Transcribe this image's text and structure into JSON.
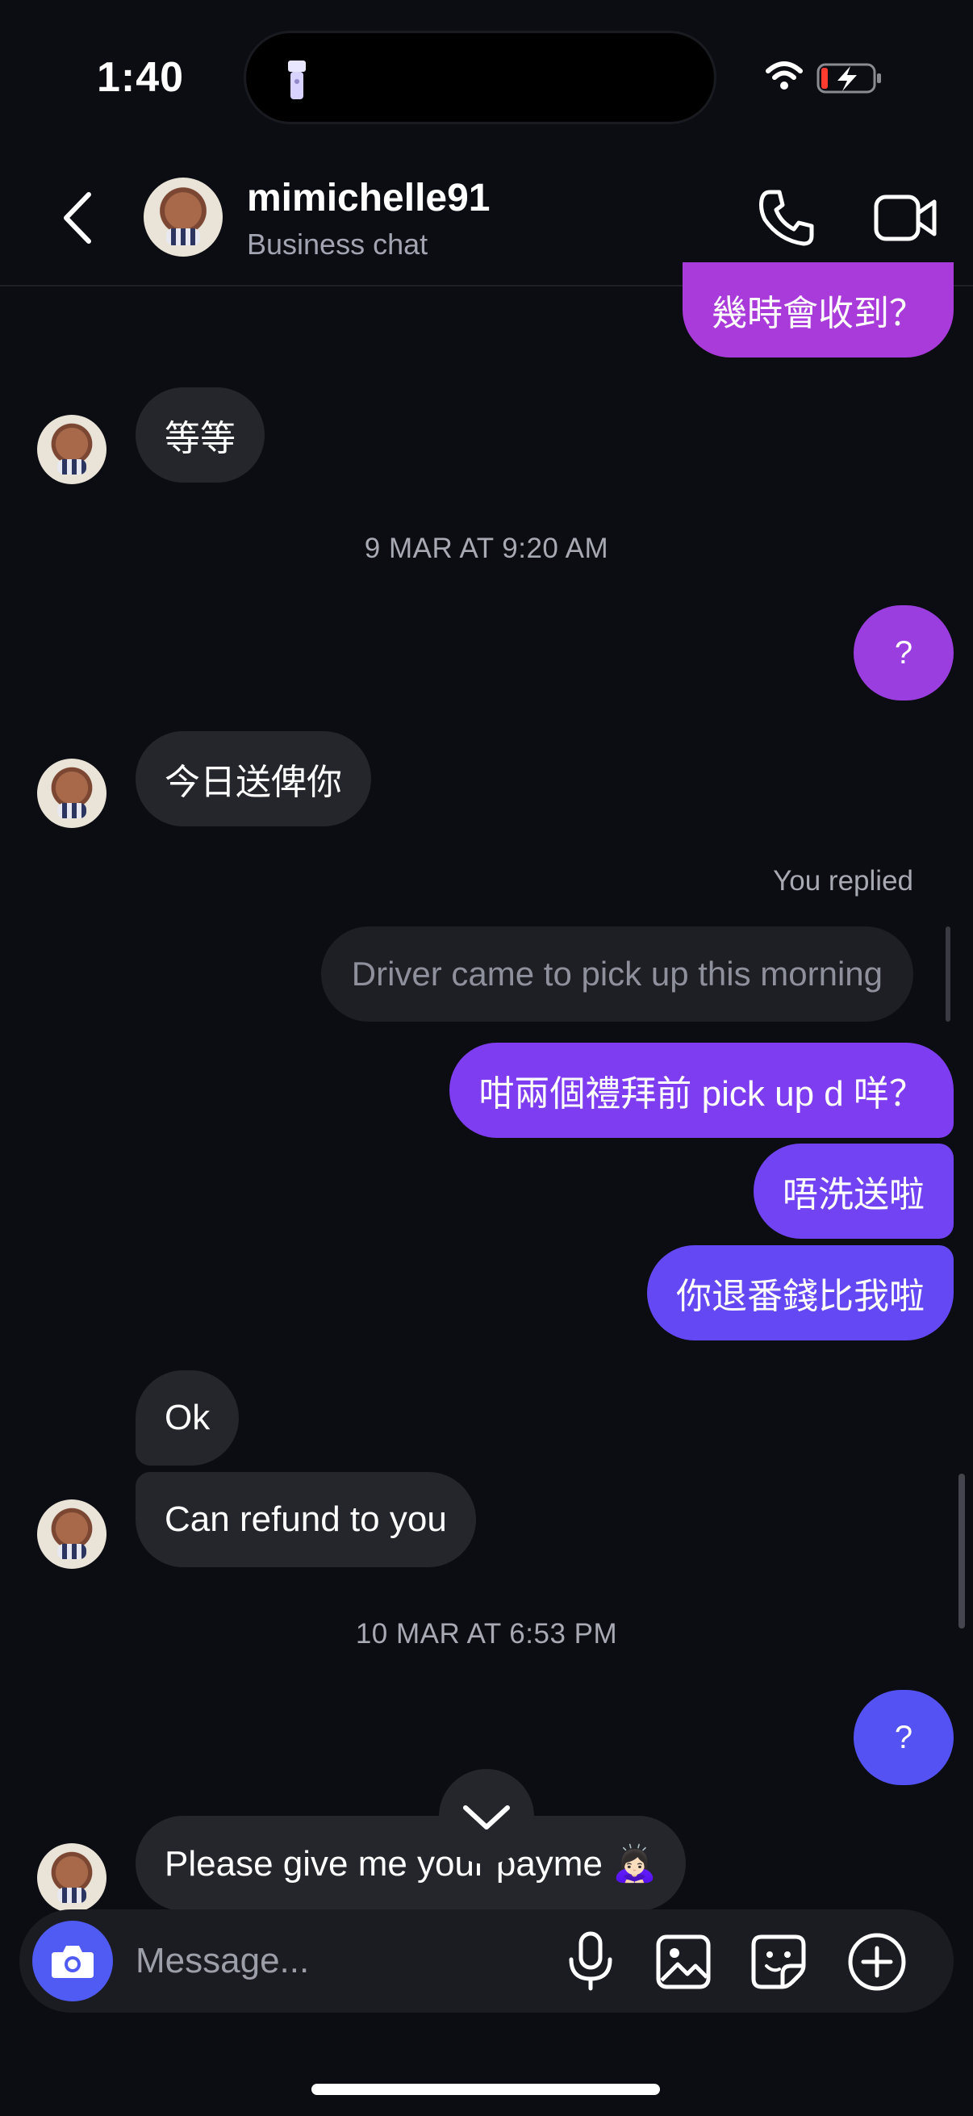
{
  "status_bar": {
    "time": "1:40"
  },
  "header": {
    "name": "mimichelle91",
    "subtitle": "Business chat"
  },
  "messages": {
    "m0": "幾時會收到？",
    "m1": "等等",
    "ts1": "9 MAR AT 9:20 AM",
    "m2": "?",
    "m3": "今日送俾你",
    "reply_label": "You replied",
    "reply_quote": "Driver came to pick up this morning",
    "m4": "咁兩個禮拜前 pick up d 咩？",
    "m5": "唔洗送啦",
    "m6": "你退番錢比我啦",
    "m7": "Ok",
    "m8": "Can refund to you",
    "ts2": "10 MAR AT 6:53 PM",
    "m9": "?",
    "m10": "Please give me your payme 🙇🏻‍♀️"
  },
  "composer": {
    "placeholder": "Message..."
  },
  "colors": {
    "background": "#0c0d12",
    "incoming_bubble": "#25262c",
    "outgoing_gradient_top": "#a33ad6",
    "outgoing_gradient_bottom": "#4f5bf3",
    "camera_button": "#4f5bf3"
  },
  "icons": {
    "back": "chevron-left-icon",
    "call": "phone-icon",
    "video": "video-camera-icon",
    "camera": "camera-icon",
    "mic": "microphone-icon",
    "gallery": "image-icon",
    "sticker": "sticker-icon",
    "plus": "plus-circle-icon",
    "scroll_down": "chevron-down-icon"
  }
}
